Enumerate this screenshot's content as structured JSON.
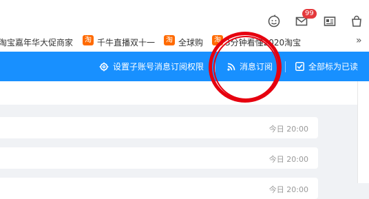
{
  "header": {
    "notification_badge": "99"
  },
  "bookmarks": {
    "items": [
      {
        "label": "淘宝嘉年华大促商家"
      },
      {
        "icon": "淘",
        "label": "千牛直播双十一"
      },
      {
        "icon": "淘",
        "label": "全球购"
      },
      {
        "icon": "淘",
        "label": "3分钟看懂2020淘宝"
      }
    ],
    "more": "»"
  },
  "toolbar": {
    "permissions_label": "设置子账号消息订阅权限",
    "subscribe_label": "消息订阅",
    "mark_all_read_label": "全部标为已读"
  },
  "messages": [
    {
      "time": "今日 20:00"
    },
    {
      "time": "今日 20:00"
    },
    {
      "time": "今日 20:00"
    }
  ],
  "colors": {
    "toolbar_bg": "#1890ff",
    "badge": "#e4393c",
    "annotation_circle": "#e6000f",
    "bookmark_icon": "#ff6a00"
  }
}
